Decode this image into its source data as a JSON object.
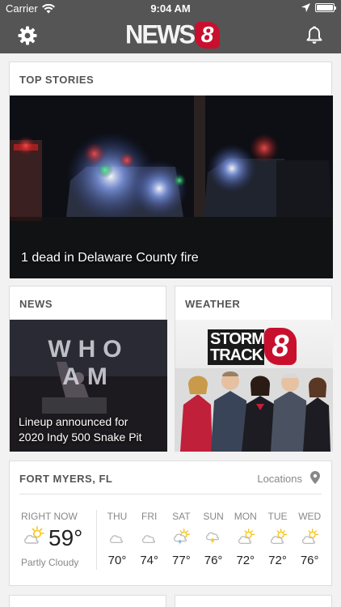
{
  "status_bar": {
    "carrier": "Carrier",
    "time": "9:04 AM",
    "battery_level": 1.0
  },
  "header": {
    "logo_text": "NEWS",
    "logo_number": "8"
  },
  "top_stories": {
    "title": "TOP STORIES",
    "headline": "1 dead in Delaware County fire"
  },
  "news": {
    "title": "NEWS",
    "image_text": "WHO AM",
    "headline_line1": "Lineup announced for",
    "headline_line2": "2020 Indy 500 Snake Pit"
  },
  "weather": {
    "title": "WEATHER",
    "logo_line1": "STORM",
    "logo_line2": "TRACK",
    "logo_number": "8"
  },
  "forecast": {
    "city": "FORT MYERS, FL",
    "locations_label": "Locations",
    "right_now": {
      "label": "RIGHT NOW",
      "temp": "59°",
      "condition": "Partly Cloudy",
      "icon": "partly-cloudy-icon"
    },
    "days": [
      {
        "name": "THU",
        "temp": "70°",
        "icon": "cloud-icon"
      },
      {
        "name": "FRI",
        "temp": "74°",
        "icon": "cloud-icon"
      },
      {
        "name": "SAT",
        "temp": "77°",
        "icon": "thunderstorm-sun-icon"
      },
      {
        "name": "SUN",
        "temp": "76°",
        "icon": "thunderstorm-cloud-icon"
      },
      {
        "name": "MON",
        "temp": "72°",
        "icon": "partly-cloudy-icon"
      },
      {
        "name": "TUE",
        "temp": "72°",
        "icon": "partly-cloudy-icon"
      },
      {
        "name": "WED",
        "temp": "76°",
        "icon": "partly-cloudy-icon"
      }
    ]
  },
  "colors": {
    "header": "#555555",
    "brand_red": "#c8102e",
    "sun": "#f5c518",
    "bolt": "#f5c518",
    "cloud": "#bbbbbb"
  }
}
